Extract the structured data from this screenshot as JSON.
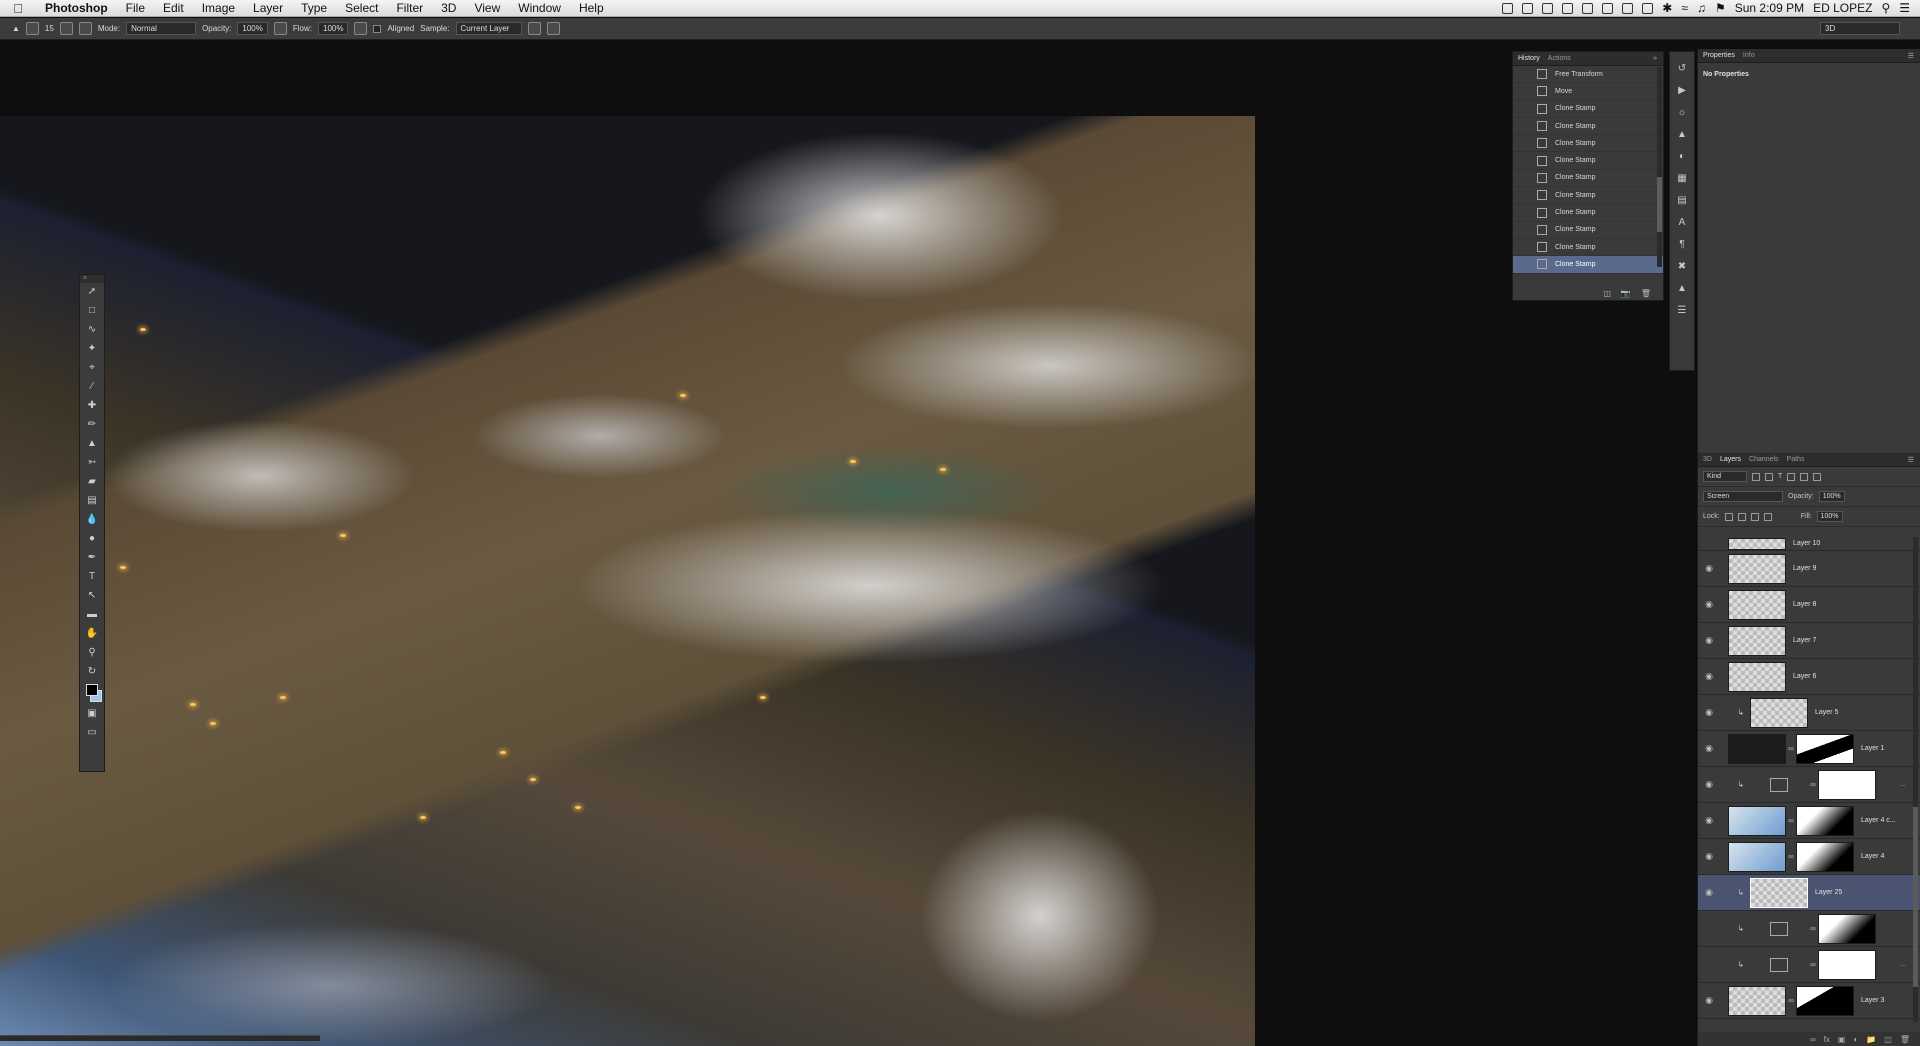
{
  "menubar": {
    "app_name": "Photoshop",
    "menus": [
      "File",
      "Edit",
      "Image",
      "Layer",
      "Type",
      "Select",
      "Filter",
      "3D",
      "View",
      "Window",
      "Help"
    ],
    "clock": "Sun 2:09 PM",
    "user": "ED LOPEZ"
  },
  "options": {
    "brush_size": "15",
    "mode_label": "Mode:",
    "mode_value": "Normal",
    "opacity_label": "Opacity:",
    "opacity_value": "100%",
    "flow_label": "Flow:",
    "flow_value": "100%",
    "aligned_label": "Aligned",
    "sample_label": "Sample:",
    "sample_value": "Current Layer",
    "workspace": "3D"
  },
  "history": {
    "tabs": [
      "History",
      "Actions"
    ],
    "items": [
      "Free Transform",
      "Move",
      "Clone Stamp",
      "Clone Stamp",
      "Clone Stamp",
      "Clone Stamp",
      "Clone Stamp",
      "Clone Stamp",
      "Clone Stamp",
      "Clone Stamp",
      "Clone Stamp",
      "Clone Stamp"
    ],
    "selected_index": 11
  },
  "properties": {
    "tabs": [
      "Properties",
      "Info"
    ],
    "body": "No Properties"
  },
  "layers_panel": {
    "tabs": [
      "3D",
      "Layers",
      "Channels",
      "Paths"
    ],
    "filter_label": "Kind",
    "blend_mode": "Screen",
    "opacity_label": "Opacity:",
    "opacity_value": "100%",
    "lock_label": "Lock:",
    "fill_label": "Fill:",
    "fill_value": "100%",
    "layers": [
      {
        "name": "Layer 10"
      },
      {
        "name": "Layer 9"
      },
      {
        "name": "Layer 8"
      },
      {
        "name": "Layer 7"
      },
      {
        "name": "Layer 6"
      },
      {
        "name": "Layer 5"
      },
      {
        "name": "Layer 1"
      },
      {
        "name": ""
      },
      {
        "name": "Layer 4 c..."
      },
      {
        "name": "Layer 4"
      },
      {
        "name": "Layer 25"
      },
      {
        "name": ""
      },
      {
        "name": ""
      },
      {
        "name": "Layer 3"
      }
    ]
  }
}
